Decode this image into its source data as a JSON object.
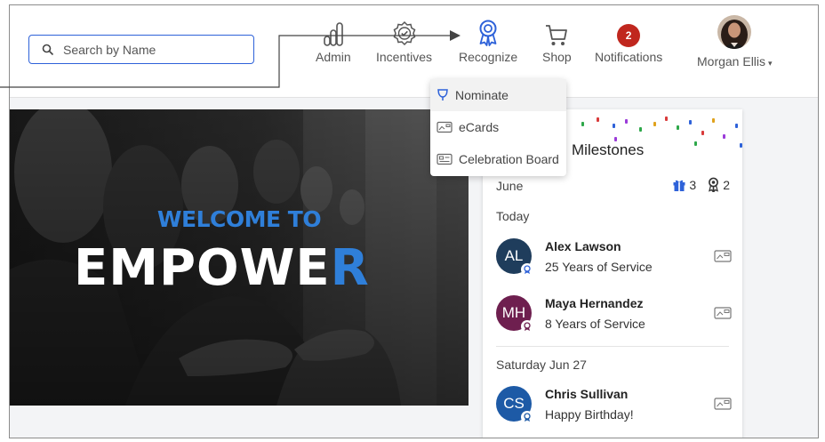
{
  "search": {
    "placeholder": "Search by Name"
  },
  "nav": {
    "admin": "Admin",
    "incentives": "Incentives",
    "recognize": "Recognize",
    "shop": "Shop",
    "notifications": "Notifications",
    "notifications_count": "2",
    "user": "Morgan Ellis"
  },
  "recognize_menu": {
    "items": [
      {
        "label": "Nominate",
        "icon": "trophy-outline-icon"
      },
      {
        "label": "eCards",
        "icon": "ecard-icon"
      },
      {
        "label": "Celebration Board",
        "icon": "board-icon"
      }
    ]
  },
  "hero": {
    "line1": "WELCOME TO",
    "line2_main": "EMPOWE",
    "line2_accent": "R"
  },
  "milestones": {
    "title": "Milestones",
    "month": "June",
    "birthday_count": "3",
    "anniversary_count": "2",
    "groups": [
      {
        "label": "Today",
        "people": [
          {
            "initials": "AL",
            "name": "Alex Lawson",
            "desc": "25 Years of Service",
            "color": "#1f3d5c"
          },
          {
            "initials": "MH",
            "name": "Maya Hernandez",
            "desc": "8 Years of Service",
            "color": "#6e1f4f"
          }
        ]
      },
      {
        "label": "Saturday Jun 27",
        "people": [
          {
            "initials": "CS",
            "name": "Chris Sullivan",
            "desc": "Happy Birthday!",
            "color": "#1d5aa6"
          }
        ]
      }
    ]
  },
  "colors": {
    "accent": "#2e62d9",
    "badge": "#c0271e",
    "brand_blue": "#2f7fd9"
  }
}
